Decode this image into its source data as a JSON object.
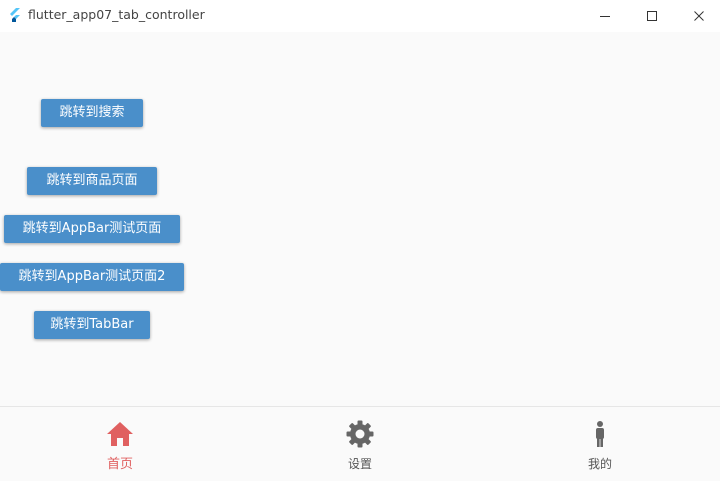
{
  "window": {
    "title": "flutter_app07_tab_controller",
    "min_glyph": "—",
    "max_glyph": "☐",
    "close_glyph": "✕"
  },
  "buttons": [
    {
      "label": "跳转到搜索"
    },
    {
      "label": "跳转到商品页面"
    },
    {
      "label": "跳转到AppBar测试页面"
    },
    {
      "label": "跳转到AppBar测试页面2"
    },
    {
      "label": "跳转到TabBar"
    }
  ],
  "bottom_nav": {
    "items": [
      {
        "label": "首页",
        "icon": "home-icon",
        "active": true
      },
      {
        "label": "设置",
        "icon": "gear-icon",
        "active": false
      },
      {
        "label": "我的",
        "icon": "person-icon",
        "active": false
      }
    ]
  },
  "colors": {
    "button_bg": "#4a8fca",
    "active_nav": "#e06060",
    "inactive_nav": "#555555"
  }
}
